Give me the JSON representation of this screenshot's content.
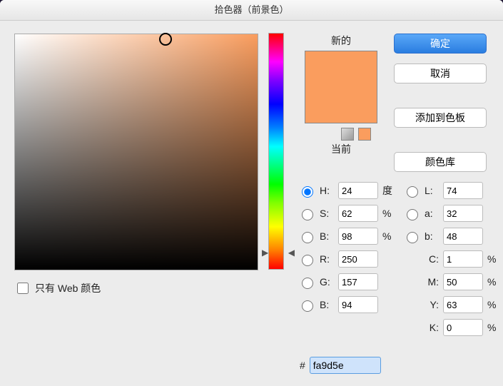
{
  "title": "拾色器（前景色）",
  "buttons": {
    "ok": "确定",
    "cancel": "取消",
    "add_swatch": "添加到色板",
    "libraries": "颜色库"
  },
  "preview": {
    "new_label": "新的",
    "current_label": "当前",
    "new_color": "#fa9d5e",
    "current_color": "#fa9d5e"
  },
  "web_only": {
    "label": "只有 Web 颜色",
    "checked": false
  },
  "hsb": {
    "h_label": "H:",
    "h_value": "24",
    "h_unit": "度",
    "s_label": "S:",
    "s_value": "62",
    "s_unit": "%",
    "b_label": "B:",
    "b_value": "98",
    "b_unit": "%",
    "selected": "H"
  },
  "rgb": {
    "r_label": "R:",
    "r_value": "250",
    "g_label": "G:",
    "g_value": "157",
    "b_label": "B:",
    "b_value": "94"
  },
  "lab": {
    "l_label": "L:",
    "l_value": "74",
    "a_label": "a:",
    "a_value": "32",
    "b_label": "b:",
    "b_value": "48"
  },
  "cmyk": {
    "c_label": "C:",
    "c_value": "1",
    "m_label": "M:",
    "m_value": "50",
    "y_label": "Y:",
    "y_value": "63",
    "k_label": "K:",
    "k_value": "0",
    "unit": "%"
  },
  "hex": {
    "prefix": "#",
    "value": "fa9d5e"
  }
}
